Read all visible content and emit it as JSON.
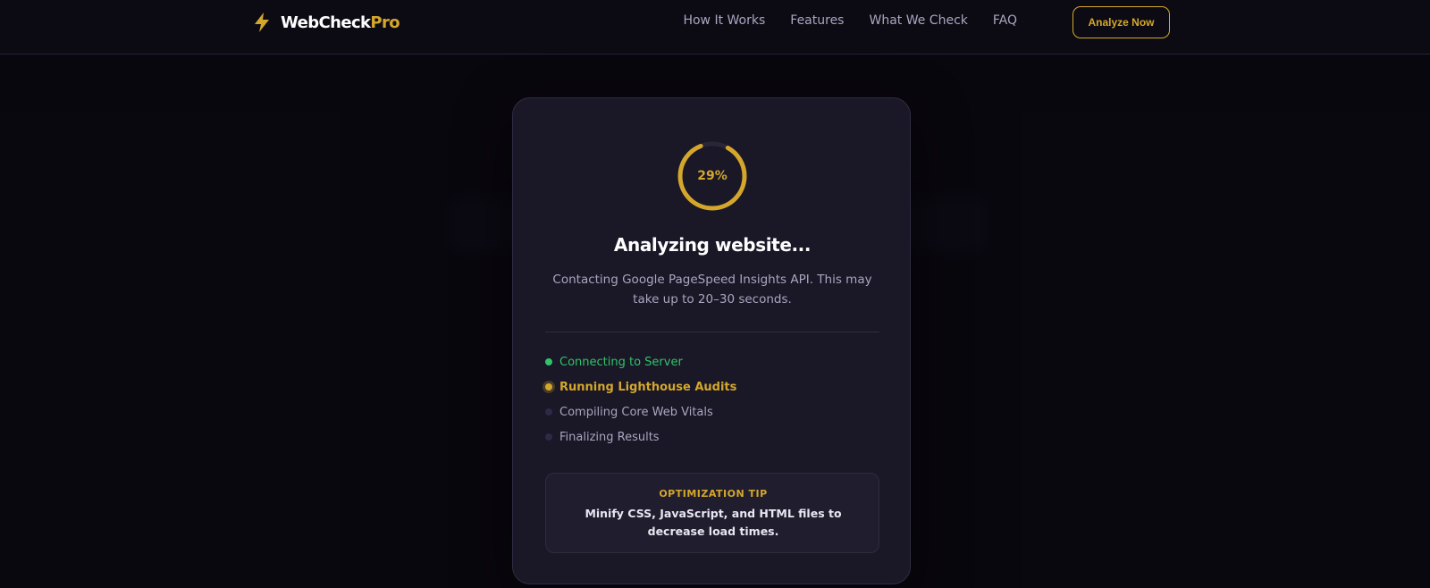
{
  "brand": {
    "name_main": "WebCheck",
    "name_accent": "Pro",
    "icon": "lightning-bolt-icon",
    "accent_color": "#d4a72c"
  },
  "nav": {
    "links": [
      "How It Works",
      "Features",
      "What We Check",
      "FAQ"
    ],
    "cta": "Analyze Now"
  },
  "loader": {
    "progress_percent": 29,
    "progress_label": "29%",
    "title": "Analyzing website...",
    "subtitle": "Contacting Google PageSpeed Insights API. This may take up to 20–30 seconds.",
    "steps": [
      {
        "label": "Connecting to Server",
        "status": "done"
      },
      {
        "label": "Running Lighthouse Audits",
        "status": "active"
      },
      {
        "label": "Compiling Core Web Vitals",
        "status": "pending"
      },
      {
        "label": "Finalizing Results",
        "status": "pending"
      }
    ],
    "tip_heading": "OPTIMIZATION TIP",
    "tip_text": "Minify CSS, JavaScript, and HTML files to decrease load times."
  },
  "colors": {
    "done": "#2fc46a",
    "active": "#d4a72c",
    "background": "#0b0a12",
    "card": "#1a1726"
  }
}
